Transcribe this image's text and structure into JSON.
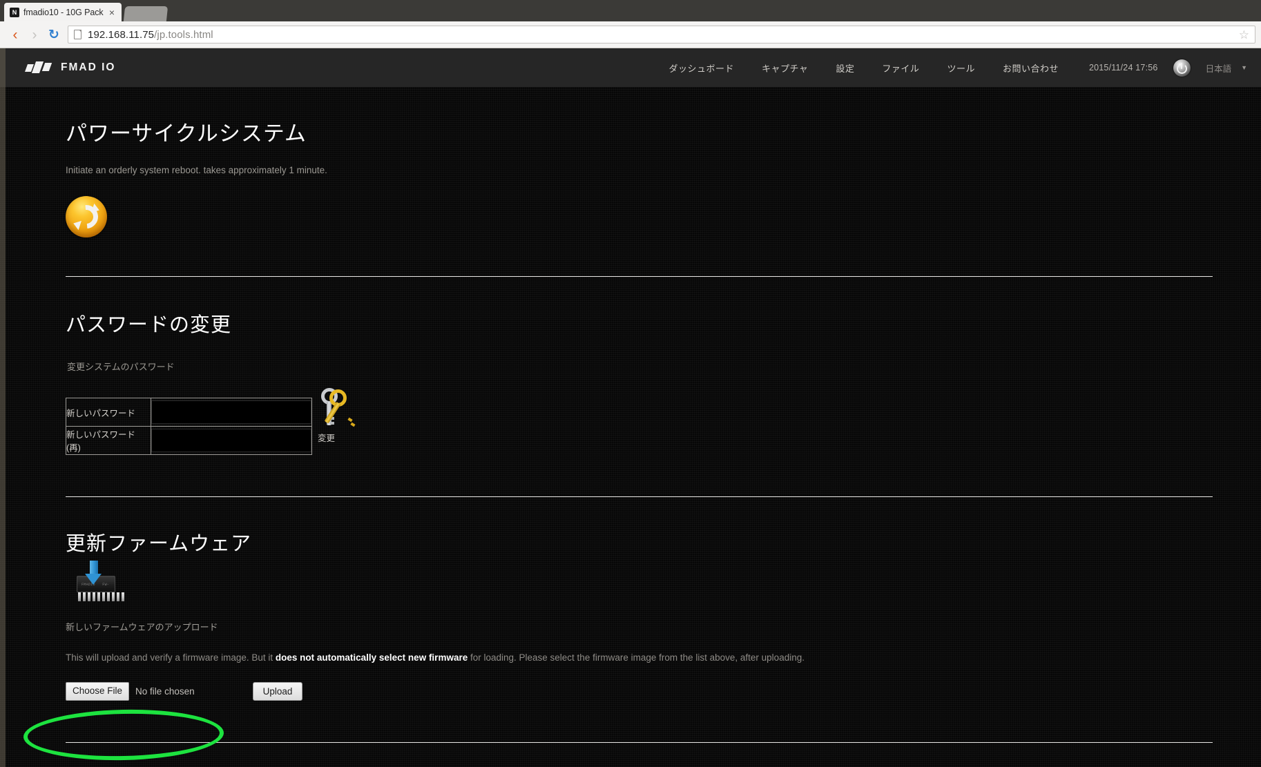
{
  "browser": {
    "tab": {
      "favicon_letter": "N",
      "title": "fmadio10 - 10G Pack",
      "close_label": "×"
    },
    "nav": {
      "back_icon": "‹",
      "forward_icon": "›",
      "reload_icon": "↻"
    },
    "url": {
      "host": "192.168.11.75",
      "path": "/jp.tools.html"
    },
    "bookmark_icon": "☆"
  },
  "topnav": {
    "brand": "FMAD IO",
    "menu": [
      {
        "label": "ダッシュボード"
      },
      {
        "label": "キャプチャ"
      },
      {
        "label": "設定"
      },
      {
        "label": "ファイル"
      },
      {
        "label": "ツール"
      },
      {
        "label": "お問い合わせ"
      }
    ],
    "clock": "2015/11/24 17:56",
    "language": "日本語",
    "language_caret": "▼"
  },
  "sections": {
    "power_cycle": {
      "title": "パワーサイクルシステム",
      "description": "Initiate an orderly system reboot. takes approximately 1 minute."
    },
    "password": {
      "title": "パスワードの変更",
      "description": "変更システムのパスワード",
      "fields": [
        {
          "label": "新しいパスワード",
          "value": "",
          "placeholder": ""
        },
        {
          "label": "新しいパスワード (再)",
          "value": "",
          "placeholder": ""
        }
      ],
      "submit_label": "変更"
    },
    "firmware": {
      "title": "更新ファームウェア",
      "chip_text_line1": "FMADIO",
      "chip_text_line2": "FW-REV",
      "subtitle": "新しいファームウェアのアップロード",
      "desc_part1": "This will upload and verify a firmware image. But it ",
      "desc_bold": "does not automatically select new firmware",
      "desc_part2": " for loading. Please select the firmware image from the list above, after uploading.",
      "choose_file_label": "Choose File",
      "no_file_label": "No file chosen",
      "upload_label": "Upload"
    }
  },
  "annotation": {
    "shape": "ellipse",
    "color": "#1de33f",
    "targets": "choose-file-control"
  }
}
